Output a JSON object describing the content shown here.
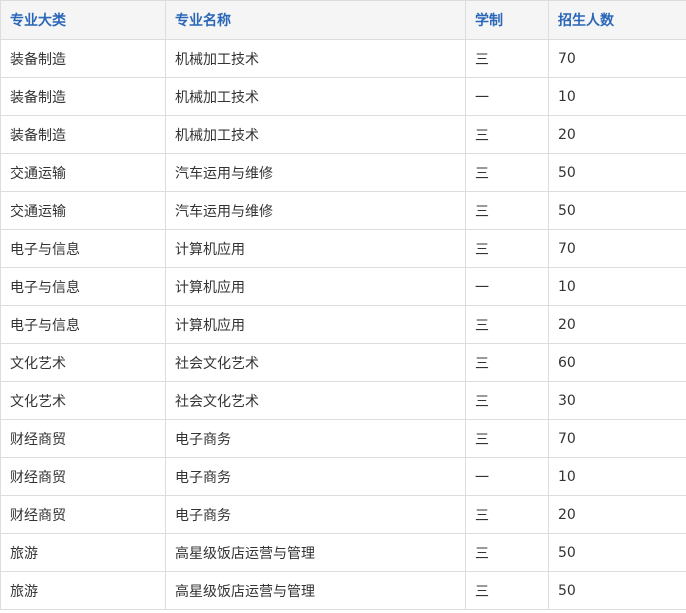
{
  "table": {
    "headers": [
      "专业大类",
      "专业名称",
      "学制",
      "招生人数"
    ],
    "rows": [
      [
        "装备制造",
        "机械加工技术",
        "三",
        "70"
      ],
      [
        "装备制造",
        "机械加工技术",
        "一",
        "10"
      ],
      [
        "装备制造",
        "机械加工技术",
        "三",
        "20"
      ],
      [
        "交通运输",
        "汽车运用与维修",
        "三",
        "50"
      ],
      [
        "交通运输",
        "汽车运用与维修",
        "三",
        "50"
      ],
      [
        "电子与信息",
        "计算机应用",
        "三",
        "70"
      ],
      [
        "电子与信息",
        "计算机应用",
        "一",
        "10"
      ],
      [
        "电子与信息",
        "计算机应用",
        "三",
        "20"
      ],
      [
        "文化艺术",
        "社会文化艺术",
        "三",
        "60"
      ],
      [
        "文化艺术",
        "社会文化艺术",
        "三",
        "30"
      ],
      [
        "财经商贸",
        "电子商务",
        "三",
        "70"
      ],
      [
        "财经商贸",
        "电子商务",
        "一",
        "10"
      ],
      [
        "财经商贸",
        "电子商务",
        "三",
        "20"
      ],
      [
        "旅游",
        "高星级饭店运营与管理",
        "三",
        "50"
      ],
      [
        "旅游",
        "高星级饭店运营与管理",
        "三",
        "50"
      ]
    ]
  },
  "colors": {
    "header_text": "#2a67b8",
    "header_bg": "#f5f5f5",
    "body_text": "#333333",
    "border": "#dddddd"
  }
}
